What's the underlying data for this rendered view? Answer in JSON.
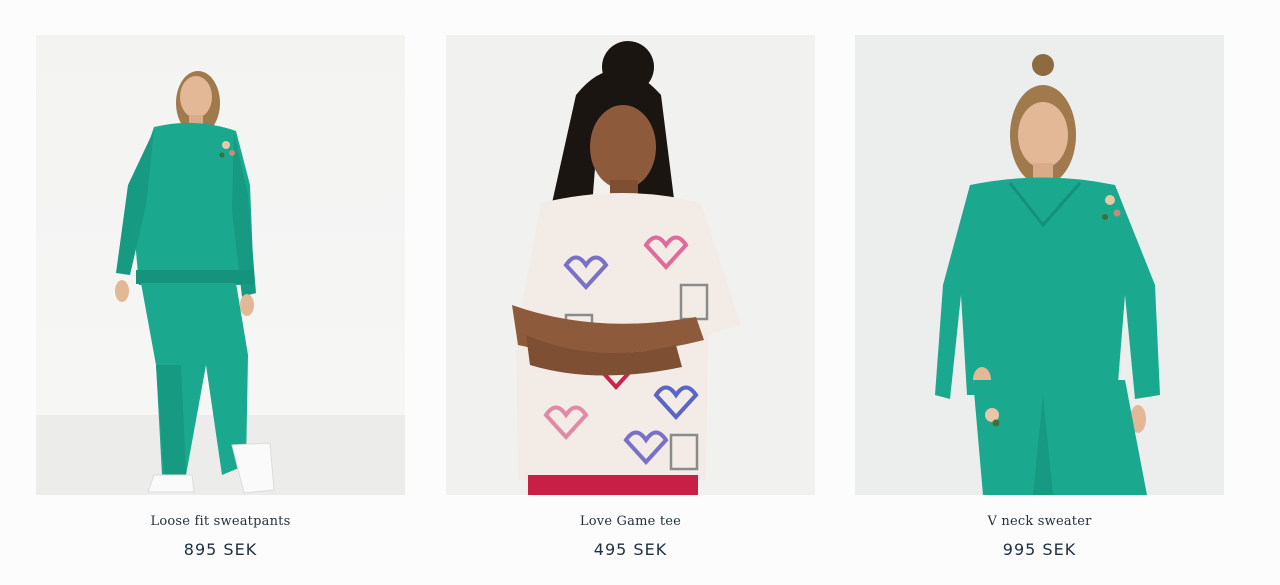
{
  "products": [
    {
      "name": "Loose fit sweatpants",
      "price": "895 SEK",
      "image_alt": "Model in teal sweatshirt and sweatpants",
      "accent_color": "#1aa88e"
    },
    {
      "name": "Love Game tee",
      "price": "495 SEK",
      "image_alt": "Model in printed heart tee with arms crossed",
      "accent_color": "#c8254b"
    },
    {
      "name": "V neck sweater",
      "price": "995 SEK",
      "image_alt": "Model in teal v neck sweater and joggers",
      "accent_color": "#1aa88e"
    }
  ]
}
